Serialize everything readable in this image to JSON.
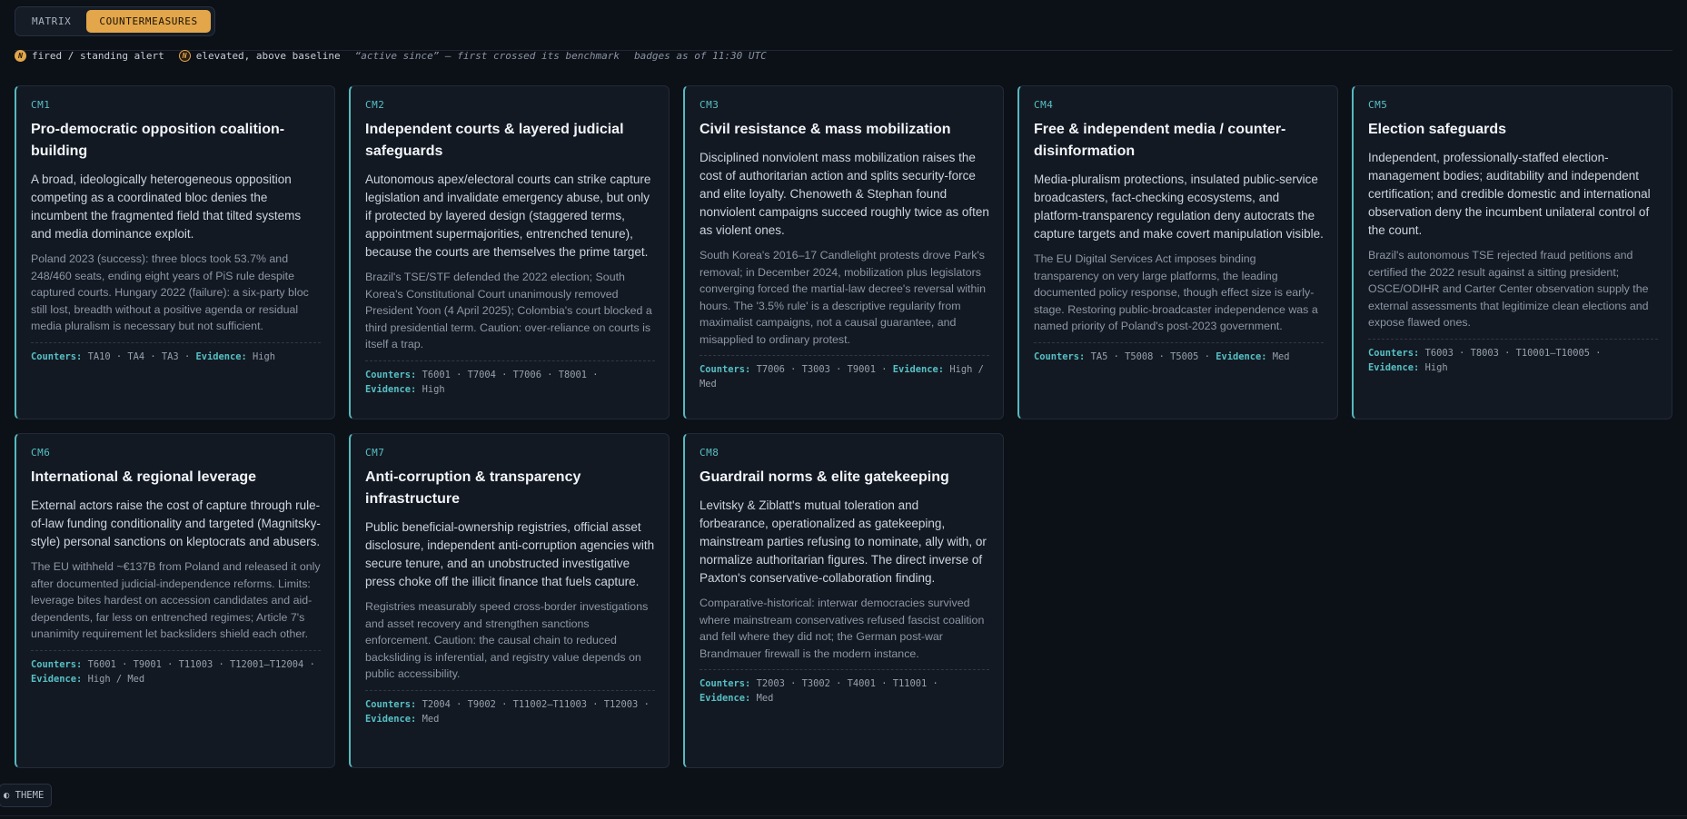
{
  "tabs": [
    {
      "label": "MATRIX",
      "active": false
    },
    {
      "label": "COUNTERMEASURES",
      "active": true
    }
  ],
  "legend": {
    "badge_glyph": "N",
    "fired_label": "fired / standing alert",
    "elevated_label": "elevated, above baseline",
    "active_since_label": "“active since” — first crossed its benchmark",
    "timestamp": "badges as of 11:30 UTC"
  },
  "labels": {
    "counters": "Counters:",
    "evidence": "Evidence:"
  },
  "colors": {
    "accent": "#55b9c0",
    "fired": "#e3a64a",
    "background": "#0c1017",
    "card": "#131922"
  },
  "cards": [
    {
      "id": "CM1",
      "title": "Pro-democratic opposition coalition-building",
      "description": "A broad, ideologically heterogeneous opposition competing as a coordinated bloc denies the incumbent the fragmented field that tilted systems and media dominance exploit.",
      "example": "Poland 2023 (success): three blocs took 53.7% and 248/460 seats, ending eight years of PiS rule despite captured courts. Hungary 2022 (failure): a six-party bloc still lost, breadth without a positive agenda or residual media pluralism is necessary but not sufficient.",
      "counters": "TA10 · TA4 · TA3",
      "evidence": "High"
    },
    {
      "id": "CM2",
      "title": "Independent courts & layered judicial safeguards",
      "description": "Autonomous apex/electoral courts can strike capture legislation and invalidate emergency abuse, but only if protected by layered design (staggered terms, appointment supermajorities, entrenched tenure), because the courts are themselves the prime target.",
      "example": "Brazil's TSE/STF defended the 2022 election; South Korea's Constitutional Court unanimously removed President Yoon (4 April 2025); Colombia's court blocked a third presidential term. Caution: over-reliance on courts is itself a trap.",
      "counters": "T6001 · T7004 · T7006 · T8001",
      "evidence": "High"
    },
    {
      "id": "CM3",
      "title": "Civil resistance & mass mobilization",
      "description": "Disciplined nonviolent mass mobilization raises the cost of authoritarian action and splits security-force and elite loyalty. Chenoweth & Stephan found nonviolent campaigns succeed roughly twice as often as violent ones.",
      "example": "South Korea's 2016–17 Candlelight protests drove Park's removal; in December 2024, mobilization plus legislators converging forced the martial-law decree's reversal within hours. The '3.5% rule' is a descriptive regularity from maximalist campaigns, not a causal guarantee, and misapplied to ordinary protest.",
      "counters": "T7006 · T3003 · T9001",
      "evidence": "High / Med"
    },
    {
      "id": "CM4",
      "title": "Free & independent media / counter-disinformation",
      "description": "Media-pluralism protections, insulated public-service broadcasters, fact-checking ecosystems, and platform-transparency regulation deny autocrats the capture targets and make covert manipulation visible.",
      "example": "The EU Digital Services Act imposes binding transparency on very large platforms, the leading documented policy response, though effect size is early-stage. Restoring public-broadcaster independence was a named priority of Poland's post-2023 government.",
      "counters": "TA5 · T5008 · T5005",
      "evidence": "Med"
    },
    {
      "id": "CM5",
      "title": "Election safeguards",
      "description": "Independent, professionally-staffed election-management bodies; auditability and independent certification; and credible domestic and international observation deny the incumbent unilateral control of the count.",
      "example": "Brazil's autonomous TSE rejected fraud petitions and certified the 2022 result against a sitting president; OSCE/ODIHR and Carter Center observation supply the external assessments that legitimize clean elections and expose flawed ones.",
      "counters": "T6003 · T8003 · T10001–T10005",
      "evidence": "High"
    },
    {
      "id": "CM6",
      "title": "International & regional leverage",
      "description": "External actors raise the cost of capture through rule-of-law funding conditionality and targeted (Magnitsky-style) personal sanctions on kleptocrats and abusers.",
      "example": "The EU withheld ~€137B from Poland and released it only after documented judicial-independence reforms. Limits: leverage bites hardest on accession candidates and aid-dependents, far less on entrenched regimes; Article 7's unanimity requirement let backsliders shield each other.",
      "counters": "T6001 · T9001 · T11003 · T12001–T12004",
      "evidence": "High / Med"
    },
    {
      "id": "CM7",
      "title": "Anti-corruption & transparency infrastructure",
      "description": "Public beneficial-ownership registries, official asset disclosure, independent anti-corruption agencies with secure tenure, and an unobstructed investigative press choke off the illicit finance that fuels capture.",
      "example": "Registries measurably speed cross-border investigations and asset recovery and strengthen sanctions enforcement. Caution: the causal chain to reduced backsliding is inferential, and registry value depends on public accessibility.",
      "counters": "T2004 · T9002 · T11002–T11003 · T12003",
      "evidence": "Med"
    },
    {
      "id": "CM8",
      "title": "Guardrail norms & elite gatekeeping",
      "description": "Levitsky & Ziblatt's mutual toleration and forbearance, operationalized as gatekeeping, mainstream parties refusing to nominate, ally with, or normalize authoritarian figures. The direct inverse of Paxton's conservative-collaboration finding.",
      "example": "Comparative-historical: interwar democracies survived where mainstream conservatives refused fascist coalition and fell where they did not; the German post-war Brandmauer firewall is the modern instance.",
      "counters": "T2003 · T3002 · T4001 · T11001",
      "evidence": "Med"
    }
  ],
  "theme_button": {
    "icon": "◐",
    "label": "THEME"
  }
}
